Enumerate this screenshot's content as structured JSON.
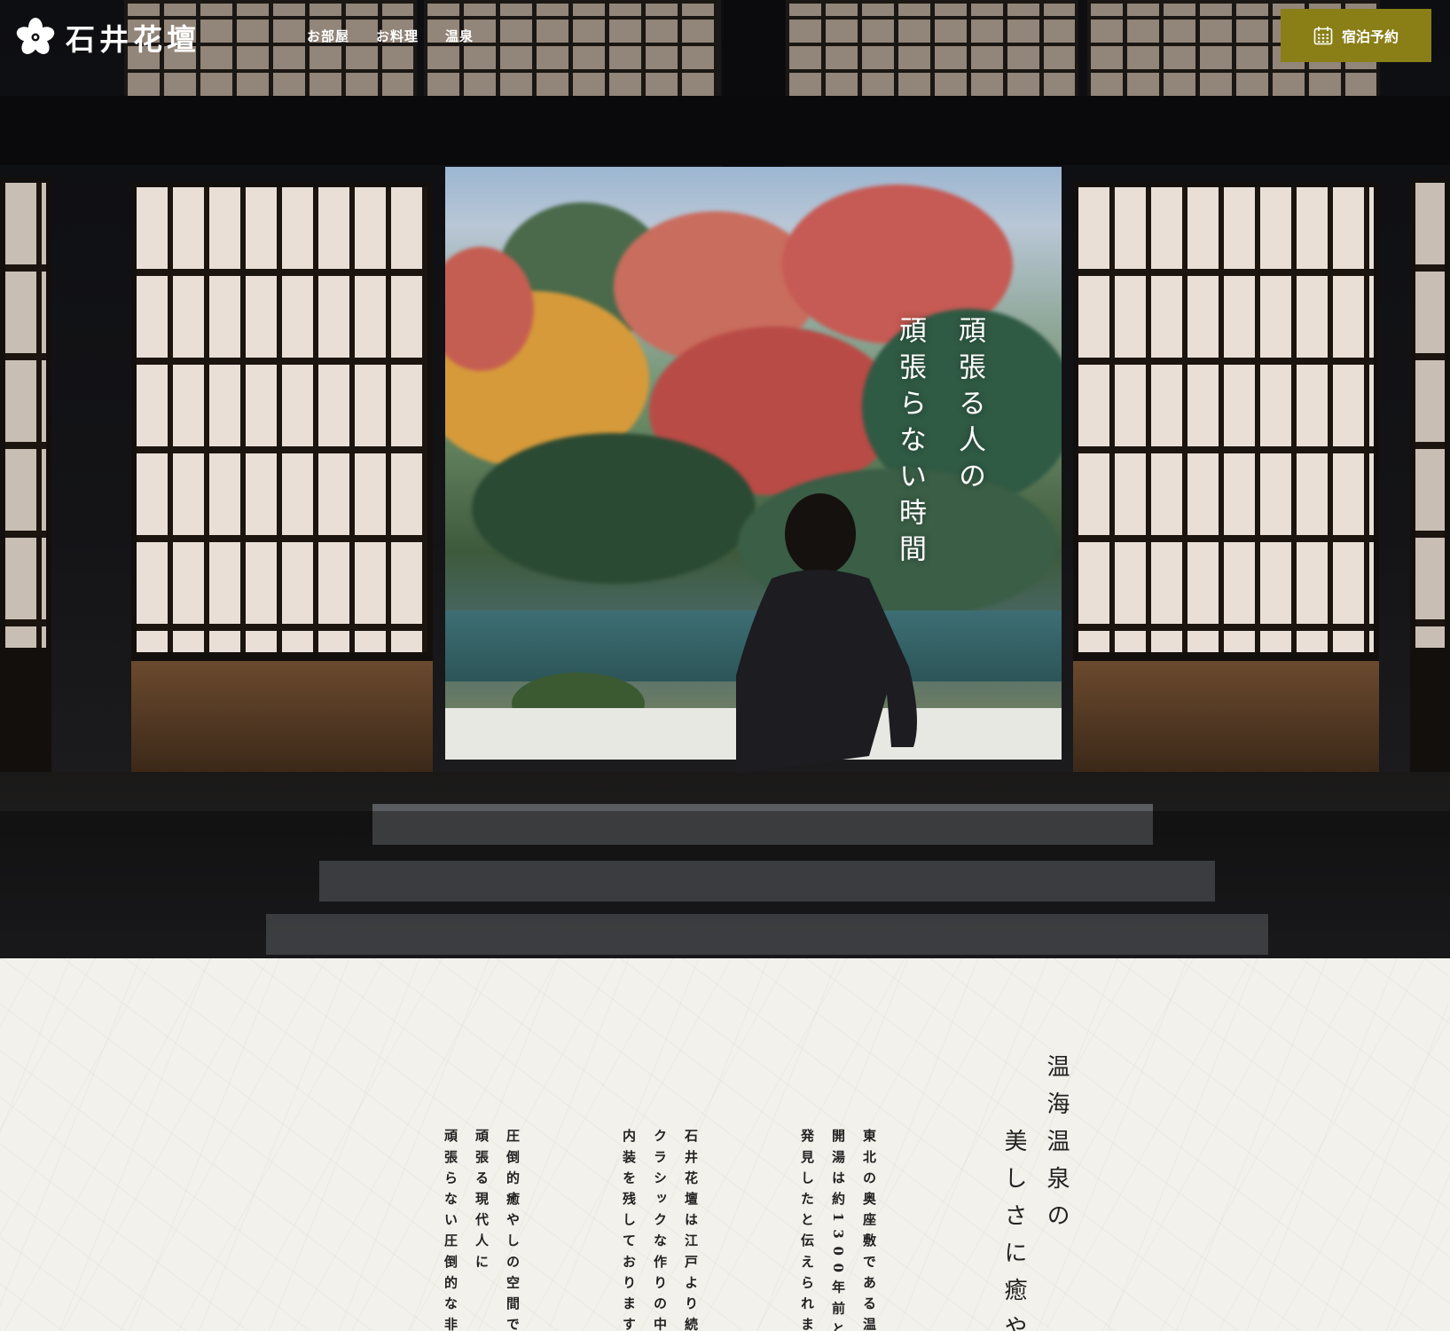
{
  "brand": {
    "name": "石井花壇",
    "logo_icon": "sakura-flower-icon"
  },
  "nav": {
    "items": [
      {
        "label": "お部屋"
      },
      {
        "label": "お料理"
      },
      {
        "label": "温泉"
      }
    ]
  },
  "reserve": {
    "label": "宿泊予約",
    "icon": "calendar-icon",
    "color": "#8a7f17"
  },
  "hero": {
    "tagline": [
      "頑張る人の",
      "頑張らない時間"
    ]
  },
  "intro": {
    "title": [
      "温海温泉の",
      "美しさに癒や"
    ],
    "paragraphs": [
      [
        "東北の奥座敷である温海",
        "開湯は約1300年前と",
        "発見したと伝えられます"
      ],
      [
        "石井花壇は江戸より続く",
        "クラシックな作りの中に",
        "内装を残しております"
      ],
      [
        "圧倒的癒やしの空間で",
        "頑張る現代人に",
        "頑張らない圧倒的な非日"
      ]
    ]
  }
}
